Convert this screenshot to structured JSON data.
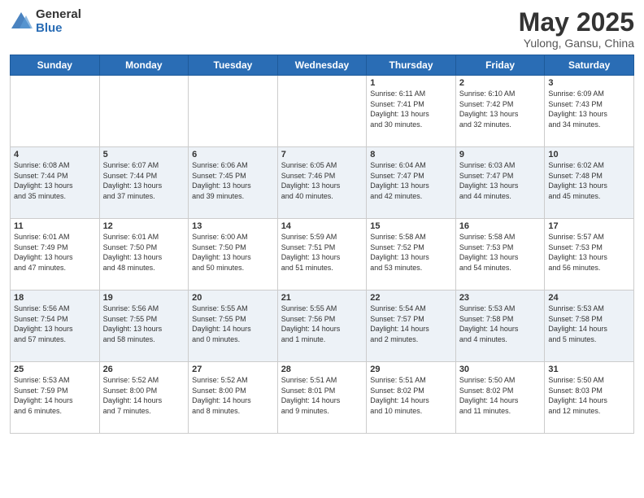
{
  "logo": {
    "general": "General",
    "blue": "Blue"
  },
  "title": {
    "month_year": "May 2025",
    "location": "Yulong, Gansu, China"
  },
  "days_of_week": [
    "Sunday",
    "Monday",
    "Tuesday",
    "Wednesday",
    "Thursday",
    "Friday",
    "Saturday"
  ],
  "weeks": [
    [
      {
        "day": "",
        "info": ""
      },
      {
        "day": "",
        "info": ""
      },
      {
        "day": "",
        "info": ""
      },
      {
        "day": "",
        "info": ""
      },
      {
        "day": "1",
        "info": "Sunrise: 6:11 AM\nSunset: 7:41 PM\nDaylight: 13 hours\nand 30 minutes."
      },
      {
        "day": "2",
        "info": "Sunrise: 6:10 AM\nSunset: 7:42 PM\nDaylight: 13 hours\nand 32 minutes."
      },
      {
        "day": "3",
        "info": "Sunrise: 6:09 AM\nSunset: 7:43 PM\nDaylight: 13 hours\nand 34 minutes."
      }
    ],
    [
      {
        "day": "4",
        "info": "Sunrise: 6:08 AM\nSunset: 7:44 PM\nDaylight: 13 hours\nand 35 minutes."
      },
      {
        "day": "5",
        "info": "Sunrise: 6:07 AM\nSunset: 7:44 PM\nDaylight: 13 hours\nand 37 minutes."
      },
      {
        "day": "6",
        "info": "Sunrise: 6:06 AM\nSunset: 7:45 PM\nDaylight: 13 hours\nand 39 minutes."
      },
      {
        "day": "7",
        "info": "Sunrise: 6:05 AM\nSunset: 7:46 PM\nDaylight: 13 hours\nand 40 minutes."
      },
      {
        "day": "8",
        "info": "Sunrise: 6:04 AM\nSunset: 7:47 PM\nDaylight: 13 hours\nand 42 minutes."
      },
      {
        "day": "9",
        "info": "Sunrise: 6:03 AM\nSunset: 7:47 PM\nDaylight: 13 hours\nand 44 minutes."
      },
      {
        "day": "10",
        "info": "Sunrise: 6:02 AM\nSunset: 7:48 PM\nDaylight: 13 hours\nand 45 minutes."
      }
    ],
    [
      {
        "day": "11",
        "info": "Sunrise: 6:01 AM\nSunset: 7:49 PM\nDaylight: 13 hours\nand 47 minutes."
      },
      {
        "day": "12",
        "info": "Sunrise: 6:01 AM\nSunset: 7:50 PM\nDaylight: 13 hours\nand 48 minutes."
      },
      {
        "day": "13",
        "info": "Sunrise: 6:00 AM\nSunset: 7:50 PM\nDaylight: 13 hours\nand 50 minutes."
      },
      {
        "day": "14",
        "info": "Sunrise: 5:59 AM\nSunset: 7:51 PM\nDaylight: 13 hours\nand 51 minutes."
      },
      {
        "day": "15",
        "info": "Sunrise: 5:58 AM\nSunset: 7:52 PM\nDaylight: 13 hours\nand 53 minutes."
      },
      {
        "day": "16",
        "info": "Sunrise: 5:58 AM\nSunset: 7:53 PM\nDaylight: 13 hours\nand 54 minutes."
      },
      {
        "day": "17",
        "info": "Sunrise: 5:57 AM\nSunset: 7:53 PM\nDaylight: 13 hours\nand 56 minutes."
      }
    ],
    [
      {
        "day": "18",
        "info": "Sunrise: 5:56 AM\nSunset: 7:54 PM\nDaylight: 13 hours\nand 57 minutes."
      },
      {
        "day": "19",
        "info": "Sunrise: 5:56 AM\nSunset: 7:55 PM\nDaylight: 13 hours\nand 58 minutes."
      },
      {
        "day": "20",
        "info": "Sunrise: 5:55 AM\nSunset: 7:55 PM\nDaylight: 14 hours\nand 0 minutes."
      },
      {
        "day": "21",
        "info": "Sunrise: 5:55 AM\nSunset: 7:56 PM\nDaylight: 14 hours\nand 1 minute."
      },
      {
        "day": "22",
        "info": "Sunrise: 5:54 AM\nSunset: 7:57 PM\nDaylight: 14 hours\nand 2 minutes."
      },
      {
        "day": "23",
        "info": "Sunrise: 5:53 AM\nSunset: 7:58 PM\nDaylight: 14 hours\nand 4 minutes."
      },
      {
        "day": "24",
        "info": "Sunrise: 5:53 AM\nSunset: 7:58 PM\nDaylight: 14 hours\nand 5 minutes."
      }
    ],
    [
      {
        "day": "25",
        "info": "Sunrise: 5:53 AM\nSunset: 7:59 PM\nDaylight: 14 hours\nand 6 minutes."
      },
      {
        "day": "26",
        "info": "Sunrise: 5:52 AM\nSunset: 8:00 PM\nDaylight: 14 hours\nand 7 minutes."
      },
      {
        "day": "27",
        "info": "Sunrise: 5:52 AM\nSunset: 8:00 PM\nDaylight: 14 hours\nand 8 minutes."
      },
      {
        "day": "28",
        "info": "Sunrise: 5:51 AM\nSunset: 8:01 PM\nDaylight: 14 hours\nand 9 minutes."
      },
      {
        "day": "29",
        "info": "Sunrise: 5:51 AM\nSunset: 8:02 PM\nDaylight: 14 hours\nand 10 minutes."
      },
      {
        "day": "30",
        "info": "Sunrise: 5:50 AM\nSunset: 8:02 PM\nDaylight: 14 hours\nand 11 minutes."
      },
      {
        "day": "31",
        "info": "Sunrise: 5:50 AM\nSunset: 8:03 PM\nDaylight: 14 hours\nand 12 minutes."
      }
    ]
  ]
}
